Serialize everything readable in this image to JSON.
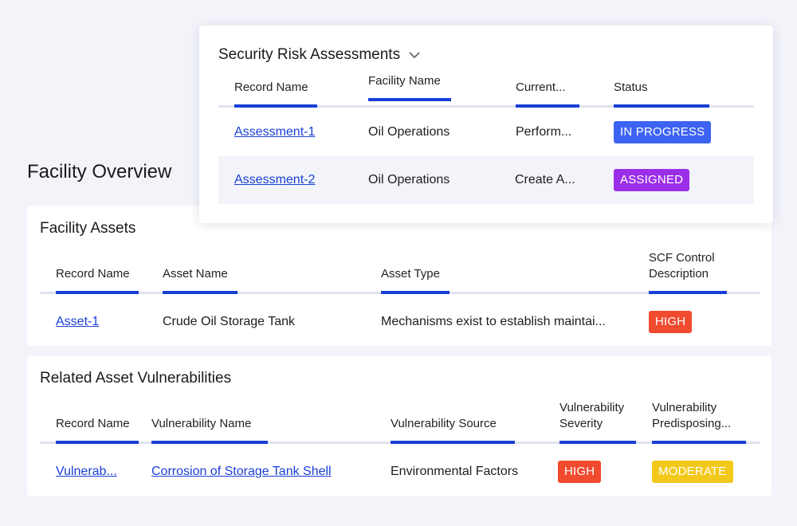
{
  "page": {
    "title": "Facility Overview"
  },
  "colors": {
    "accent": "#1a3fd6",
    "in_progress": "#3d63f2",
    "assigned": "#9b2fe8",
    "high": "#f04a2f",
    "moderate": "#f2c81b"
  },
  "popup": {
    "title": "Security Risk Assessments",
    "dropdown_icon": "chevron-down-icon",
    "columns": [
      "Record Name",
      "Facility Name",
      "Current...",
      "Status"
    ],
    "rows": [
      {
        "record": "Assessment-1",
        "facility": "Oil Operations",
        "current": "Perform...",
        "status": "IN PROGRESS"
      },
      {
        "record": "Assessment-2",
        "facility": "Oil Operations",
        "current": "Create A...",
        "status": "ASSIGNED"
      }
    ]
  },
  "assets": {
    "title": "Facility Assets",
    "columns": [
      "Record Name",
      "Asset Name",
      "Asset Type",
      "SCF Control Description"
    ],
    "rows": [
      {
        "record": "Asset-1",
        "name": "Crude Oil Storage Tank",
        "type": "Mechanisms exist to establish  maintai...",
        "scf": "HIGH"
      }
    ]
  },
  "vulns": {
    "title": "Related Asset Vulnerabilities",
    "columns": [
      "Record Name",
      "Vulnerability Name",
      "Vulnerability Source",
      "Vulnerability Severity",
      "Vulnerability Predisposing..."
    ],
    "rows": [
      {
        "record": "Vulnerab...",
        "name": "Corrosion of Storage Tank Shell",
        "source": "Environmental Factors",
        "severity": "HIGH",
        "predisposing": "MODERATE"
      }
    ]
  }
}
